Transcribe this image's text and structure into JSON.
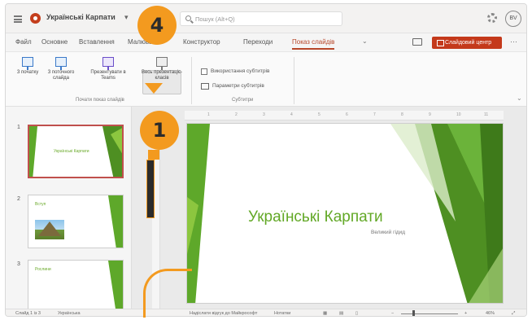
{
  "titlebar": {
    "doc_title": "Українські Карпати",
    "search_placeholder": "Пошук (Alt+Q)",
    "avatar_initials": "BV"
  },
  "menu": {
    "tabs": [
      "Файл",
      "Основне",
      "Вставлення",
      "Малювання",
      "Конструктор",
      "Переходи",
      "Показ слайдів"
    ],
    "active_tab": "Показ слайдів",
    "present_button": "Слайдовий центр"
  },
  "ribbon": {
    "buttons": [
      {
        "label": "З початку"
      },
      {
        "label": "З поточного слайда"
      },
      {
        "label": "Презентувати в Teams"
      },
      {
        "label": "Весь презентаціє-класів"
      }
    ],
    "group1_label": "Почати показ слайдів",
    "checkbox_label": "Використання субтитрів",
    "subtitle_settings": "Параметри субтитрів",
    "group2_label": "Субтитри"
  },
  "slides": [
    {
      "number": "1",
      "title": "Українські Карпати"
    },
    {
      "number": "2",
      "title": "Вступ"
    },
    {
      "number": "3",
      "title": "Рослини"
    }
  ],
  "main_slide": {
    "title": "Українські Карпати",
    "subtitle": "Великий гідид"
  },
  "ruler": [
    "1",
    "2",
    "3",
    "4",
    "5",
    "6",
    "7",
    "8",
    "9",
    "10",
    "11"
  ],
  "statusbar": {
    "slide_info": "Слайд 1 із 3",
    "language": "Українська",
    "feedback": "Надіслати відгук до Майкрософт",
    "notes": "Нотатки",
    "zoom": "46%"
  },
  "callouts": [
    "4",
    "1"
  ],
  "colors": {
    "accent": "#b7472a",
    "green": "#62a826",
    "badge": "#f39a1f"
  }
}
